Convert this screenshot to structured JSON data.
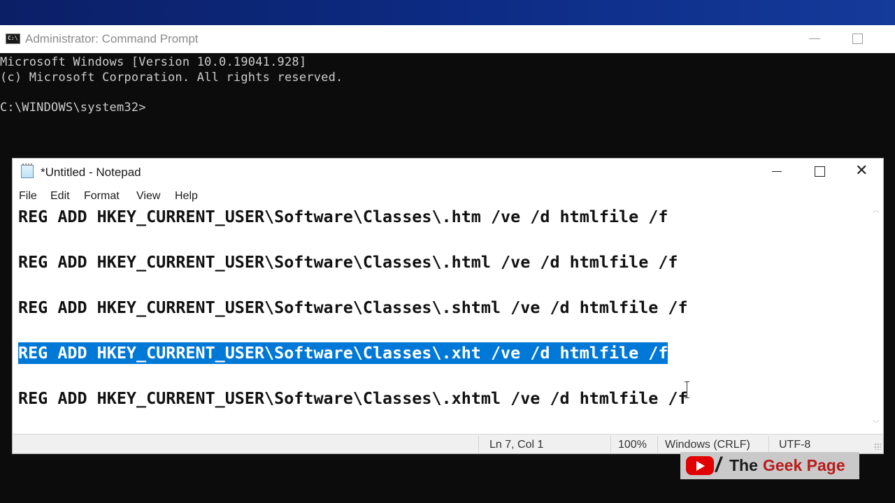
{
  "cmd": {
    "title": "Administrator: Command Prompt",
    "icon_text": "C:\\",
    "lines": [
      "Microsoft Windows [Version 10.0.19041.928]",
      "(c) Microsoft Corporation. All rights reserved.",
      "",
      "C:\\WINDOWS\\system32>"
    ]
  },
  "notepad": {
    "title": "*Untitled - Notepad",
    "close_glyph": "✕",
    "menu": [
      "File",
      "Edit",
      "Format",
      "View",
      "Help"
    ],
    "lines": [
      "REG ADD HKEY_CURRENT_USER\\Software\\Classes\\.htm /ve /d htmlfile /f",
      "REG ADD HKEY_CURRENT_USER\\Software\\Classes\\.html /ve /d htmlfile /f",
      "REG ADD HKEY_CURRENT_USER\\Software\\Classes\\.shtml /ve /d htmlfile /f",
      "REG ADD HKEY_CURRENT_USER\\Software\\Classes\\.xht /ve /d htmlfile /f",
      "REG ADD HKEY_CURRENT_USER\\Software\\Classes\\.xhtml /ve /d htmlfile /f"
    ],
    "selected_line_index": 3,
    "status": {
      "position": "Ln 7, Col 1",
      "zoom": "100%",
      "line_ending": "Windows (CRLF)",
      "encoding": "UTF-8"
    },
    "scroll_up_glyph": "︿",
    "scroll_down_glyph": "﹀"
  },
  "watermark": {
    "slash": "/",
    "the": "The",
    "rest": "Geek Page",
    "icon": "youtube-icon"
  },
  "colors": {
    "selection": "#0078d7",
    "console_bg": "#0c0c0c",
    "console_text": "#cccccc"
  }
}
